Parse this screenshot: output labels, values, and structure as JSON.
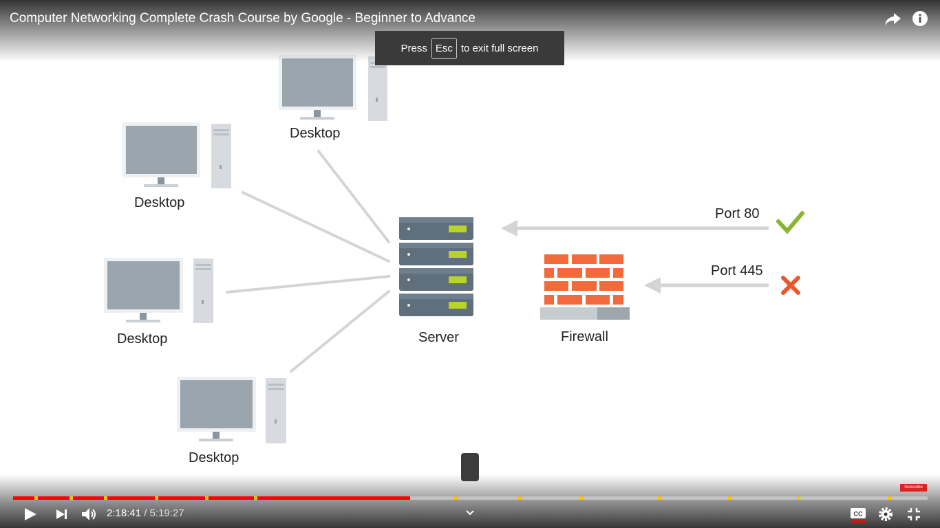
{
  "player": {
    "video_title": "Computer Networking Complete Crash Course by Google - Beginner to Advance",
    "fullscreen_notice": {
      "prefix": "Press",
      "key": "Esc",
      "suffix": "to exit full screen"
    },
    "time_current": "2:18:41",
    "time_separator": "/",
    "time_duration": "5:19:27",
    "progress_fraction": 0.434,
    "chapter_marker_fractions": [
      0.023,
      0.062,
      0.099,
      0.155,
      0.21,
      0.263,
      0.482,
      0.552,
      0.62,
      0.705,
      0.782,
      0.857,
      0.956
    ],
    "subscribe_badge": "Subscribe",
    "icons": {
      "share": "share-icon",
      "info": "info-icon",
      "play": "play-icon",
      "next": "next-icon",
      "volume": "volume-icon",
      "chevron": "chevron-down-icon",
      "captions": "captions-icon",
      "settings": "gear-icon",
      "exit_fullscreen": "exit-fullscreen-icon"
    },
    "colors": {
      "progress_played": "#ff0000",
      "chapter_marker": "#f5c400",
      "captions_active": "#ff0000"
    }
  },
  "diagram": {
    "desktop_labels": [
      "Desktop",
      "Desktop",
      "Desktop",
      "Desktop"
    ],
    "server_label": "Server",
    "firewall_label": "Firewall",
    "port_allowed": "Port 80",
    "port_blocked": "Port 445"
  }
}
